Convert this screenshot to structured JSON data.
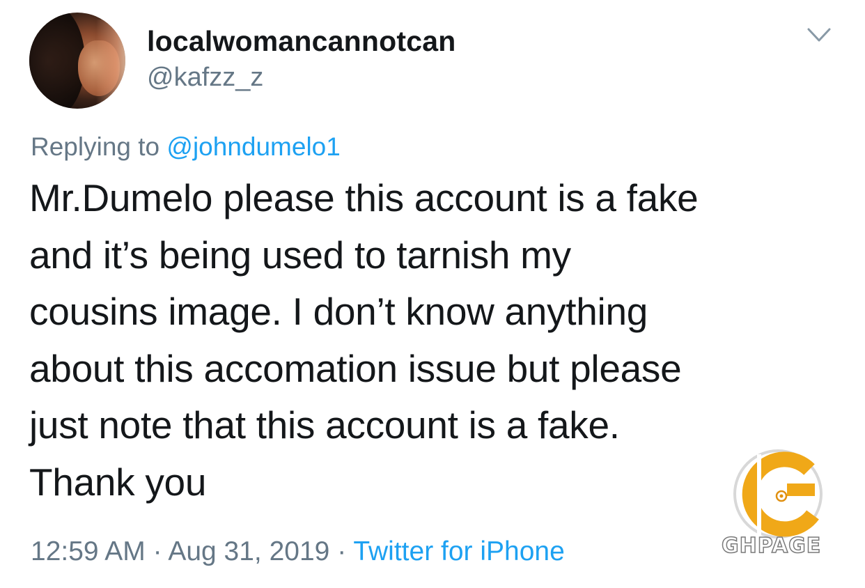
{
  "user": {
    "display_name": "localwomancannotcan",
    "handle": "@kafzz_z"
  },
  "icons": {
    "more": "chevron-down-icon",
    "watermark": "ghpage-logo"
  },
  "reply": {
    "prefix": "Replying to",
    "mention": "@johndumelo1"
  },
  "tweet": {
    "lines": [
      "Mr.Dumelo please this account is a fake",
      "and it’s being used to tarnish my",
      "cousins image. I don’t know anything",
      "about this accomation issue but please",
      "just note that this account is a fake.",
      "Thank you"
    ]
  },
  "meta": {
    "time": "12:59 AM",
    "separator": "·",
    "date": "Aug 31, 2019",
    "source": "Twitter for iPhone"
  },
  "watermark": {
    "text": "GHPAGE"
  },
  "colors": {
    "text": "#14171a",
    "secondary": "#657786",
    "link": "#1da1f2",
    "logo_orange": "#f0a818"
  }
}
